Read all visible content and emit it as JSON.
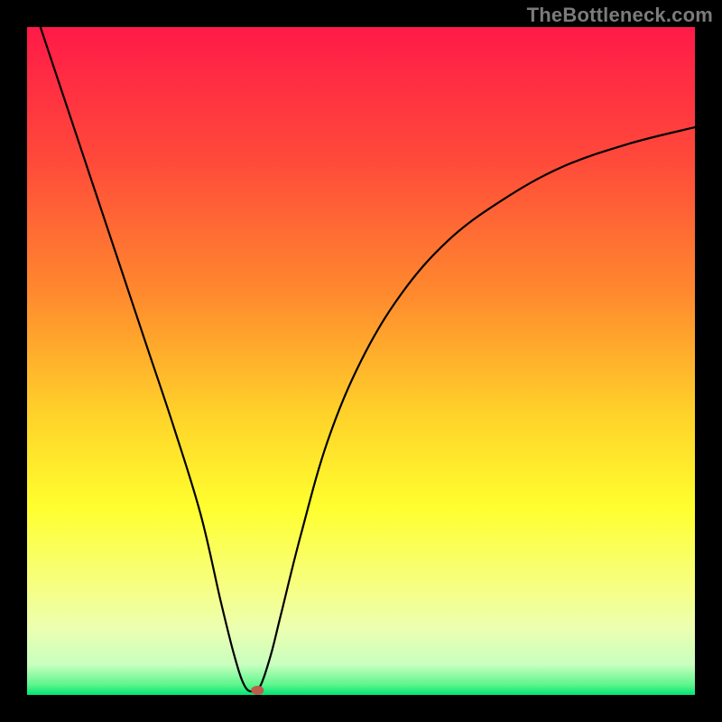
{
  "watermark_text": "TheBottleneck.com",
  "chart_data": {
    "type": "line",
    "title": "",
    "xlabel": "",
    "ylabel": "",
    "xlim": [
      0,
      100
    ],
    "ylim": [
      0,
      100
    ],
    "curve": {
      "description": "V-shaped bottleneck curve with minimum near x≈33, left branch from top-left corner, right branch rising asymptotically to the right edge",
      "points_xy": [
        [
          2,
          100
        ],
        [
          6,
          88
        ],
        [
          10,
          76
        ],
        [
          14,
          64
        ],
        [
          18,
          52
        ],
        [
          22,
          40
        ],
        [
          26,
          27
        ],
        [
          29,
          14
        ],
        [
          31,
          6
        ],
        [
          32.5,
          1.5
        ],
        [
          33.8,
          0.5
        ],
        [
          35,
          1.5
        ],
        [
          36.5,
          6
        ],
        [
          38,
          12
        ],
        [
          41,
          24
        ],
        [
          45,
          38
        ],
        [
          50,
          50
        ],
        [
          56,
          60
        ],
        [
          63,
          68
        ],
        [
          71,
          74
        ],
        [
          80,
          79
        ],
        [
          90,
          82.5
        ],
        [
          100,
          85
        ]
      ]
    },
    "marker": {
      "x": 34.5,
      "y": 0.7,
      "color": "#c05a4a",
      "rx": 7,
      "ry": 5
    },
    "gradient_stops": [
      {
        "offset": 0.0,
        "color": "#ff1a48"
      },
      {
        "offset": 0.2,
        "color": "#ff4a3a"
      },
      {
        "offset": 0.4,
        "color": "#ff8a2e"
      },
      {
        "offset": 0.58,
        "color": "#ffd22a"
      },
      {
        "offset": 0.72,
        "color": "#ffff2e"
      },
      {
        "offset": 0.84,
        "color": "#f6ff84"
      },
      {
        "offset": 0.9,
        "color": "#ecffb0"
      },
      {
        "offset": 0.955,
        "color": "#c8ffbf"
      },
      {
        "offset": 0.985,
        "color": "#5cf58c"
      },
      {
        "offset": 1.0,
        "color": "#00e574"
      }
    ]
  }
}
